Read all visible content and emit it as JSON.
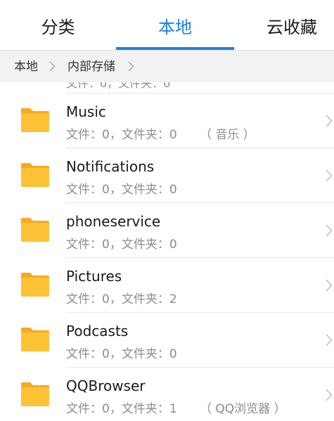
{
  "tabs": [
    {
      "label": "分类",
      "active": false
    },
    {
      "label": "本地",
      "active": true
    },
    {
      "label": "云收藏",
      "active": false
    }
  ],
  "breadcrumb": [
    "本地",
    "内部存储"
  ],
  "colors": {
    "accent": "#1f7fe0",
    "folder": "#fbc02d",
    "secondary_text": "#8c8c8c"
  },
  "icons": {
    "folder": "folder-icon",
    "chevron": "chevron-right-icon"
  },
  "clipped_row_text": "文件：0，文件夹：0",
  "folders": [
    {
      "name": "Music",
      "meta": "文件：0，文件夹：0",
      "alias": "（ 音乐 ）"
    },
    {
      "name": "Notifications",
      "meta": "文件：0，文件夹：0",
      "alias": ""
    },
    {
      "name": "phoneservice",
      "meta": "文件：0，文件夹：0",
      "alias": ""
    },
    {
      "name": "Pictures",
      "meta": "文件：0，文件夹：2",
      "alias": ""
    },
    {
      "name": "Podcasts",
      "meta": "文件：0，文件夹：0",
      "alias": ""
    },
    {
      "name": "QQBrowser",
      "meta": "文件：0，文件夹：1",
      "alias": "（ QQ浏览器 ）"
    }
  ]
}
